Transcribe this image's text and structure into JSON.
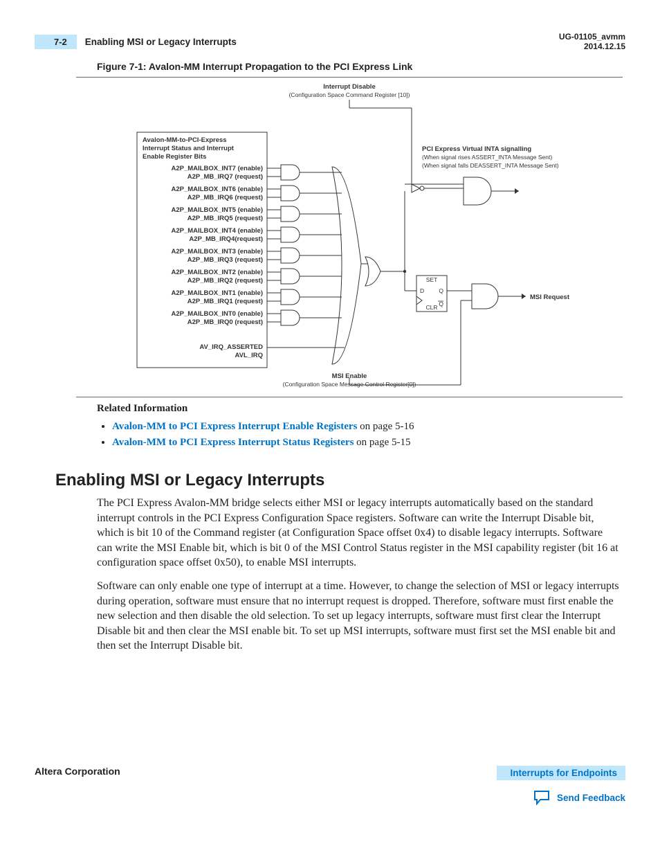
{
  "header": {
    "pageNum": "7-2",
    "topicTitle": "Enabling MSI or Legacy Interrupts",
    "docId": "UG-01105_avmm",
    "docDate": "2014.12.15"
  },
  "figure": {
    "caption": "Figure 7-1: Avalon-MM Interrupt Propagation to the PCI Express Link",
    "topLabel1": "Interrupt Disable",
    "topLabel2": "(Configuration Space Command Register [10])",
    "boxTitle1": "Avalon-MM-to-PCI-Express",
    "boxTitle2": "Interrupt Status and Interrupt",
    "boxTitle3": "Enable Register Bits",
    "signalPairs": [
      {
        "enable": "A2P_MAILBOX_INT7 (enable)",
        "request": "A2P_MB_IRQ7 (request)"
      },
      {
        "enable": "A2P_MAILBOX_INT6 (enable)",
        "request": "A2P_MB_IRQ6 (request)"
      },
      {
        "enable": "A2P_MAILBOX_INT5 (enable)",
        "request": "A2P_MB_IRQ5 (request)"
      },
      {
        "enable": "A2P_MAILBOX_INT4 (enable)",
        "request": "A2P_MB_IRQ4(request)"
      },
      {
        "enable": "A2P_MAILBOX_INT3 (enable)",
        "request": "A2P_MB_IRQ3 (request)"
      },
      {
        "enable": "A2P_MAILBOX_INT2 (enable)",
        "request": "A2P_MB_IRQ2 (request)"
      },
      {
        "enable": "A2P_MAILBOX_INT1 (enable)",
        "request": "A2P_MB_IRQ1 (request)"
      },
      {
        "enable": "A2P_MAILBOX_INT0 (enable)",
        "request": "A2P_MB_IRQ0 (request)"
      }
    ],
    "irqAsserted": "AV_IRQ_ASSERTED",
    "avlIrq": "AVL_IRQ",
    "intaLabel1": "PCI Express Virtual INTA signalling",
    "intaLabel2": "(When signal rises ASSERT_INTA Message Sent)",
    "intaLabel3": "(When signal falls DEASSERT_INTA Message Sent)",
    "ffSet": "SET",
    "ffD": "D",
    "ffQ": "Q",
    "ffQbar": "Q",
    "ffClr": "CLR",
    "msiRequest": "MSI Request",
    "bottomLabel1": "MSI Enable",
    "bottomLabel2": "(Configuration Space Message Control Register[0])"
  },
  "related": {
    "heading": "Related Information",
    "items": [
      {
        "linkText": "Avalon-MM to PCI Express Interrupt Enable Registers",
        "suffix": " on page 5-16"
      },
      {
        "linkText": "Avalon-MM to PCI Express Interrupt Status Registers",
        "suffix": " on page 5-15"
      }
    ]
  },
  "section": {
    "heading": "Enabling MSI or Legacy Interrupts",
    "para1": "The PCI Express Avalon-MM bridge selects either MSI or legacy interrupts automatically based on the standard interrupt controls in the PCI Express Configuration Space registers. Software can write the Interrupt Disable bit, which is bit 10 of the Command register (at Configuration Space offset 0x4) to disable legacy interrupts. Software can write the MSI Enable bit, which is bit 0 of the MSI Control Status register in the MSI capability register (bit 16 at configuration space offset 0x50), to enable MSI interrupts.",
    "para2": "Software can only enable one type of interrupt at a time. However, to change the selection of MSI or legacy interrupts during operation, software must ensure that no interrupt request is dropped. Therefore, software must first enable the new selection and then disable the old selection. To set up legacy interrupts, software must first clear the Interrupt Disable bit and then clear the MSI enable bit. To set up MSI interrupts, software must first set the MSI enable bit and then set the Interrupt Disable bit."
  },
  "footer": {
    "left": "Altera Corporation",
    "rightLink": "Interrupts for Endpoints",
    "feedback": "Send Feedback"
  }
}
